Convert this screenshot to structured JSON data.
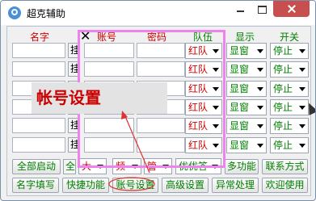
{
  "window": {
    "title": "超克辅助"
  },
  "headers": {
    "name": "名字",
    "account": "账号",
    "password": "密码",
    "team": "队伍",
    "display": "显示",
    "switch": "开关"
  },
  "row_stub_label": "挂",
  "rows": [
    {
      "team": "红队",
      "display": "显窗",
      "switch": "停止"
    },
    {
      "team": "红队",
      "display": "显窗",
      "switch": "停止"
    },
    {
      "team": "红队",
      "display": "显窗",
      "switch": "停止"
    },
    {
      "team": "红队",
      "display": "显窗",
      "switch": "停止"
    },
    {
      "team": "红队",
      "display": "显窗",
      "switch": "停止"
    },
    {
      "team": "红队",
      "display": "显窗",
      "switch": "停止"
    }
  ],
  "toolbar1": {
    "start_all": "全部启动",
    "stub": "全",
    "combo1": "大",
    "combo2": "频",
    "combo3": "管",
    "combo4": "优优答",
    "multi_func": "多功能",
    "contact": "联系方式"
  },
  "toolbar2": {
    "name_fill": "名字填写",
    "shortcut": "快捷功能",
    "account_settings": "账号设置",
    "advanced": "高级设置",
    "exception": "异常处理",
    "welcome": "欢迎使用"
  },
  "annotation": {
    "tooltip": "帐号设置",
    "close_mark": "✕"
  },
  "colors": {
    "header_red": "#cc0000",
    "button_green": "#008000",
    "highlight_pink": "#ee82ee",
    "annotation_red": "#e03030"
  }
}
